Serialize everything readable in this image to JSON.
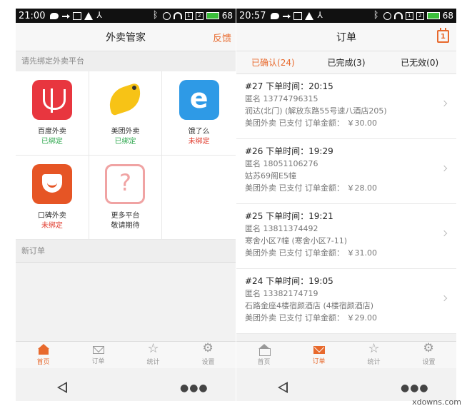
{
  "left_screen": {
    "status": {
      "time": "21:00",
      "battery": "68"
    },
    "header": {
      "title": "外卖管家",
      "feedback": "反馈"
    },
    "bind_section": "请先绑定外卖平台",
    "platforms": [
      {
        "name": "百度外卖",
        "status": "已绑定",
        "icon": "baidu-waimai-logo"
      },
      {
        "name": "美团外卖",
        "status": "已绑定",
        "icon": "meituan-waimai-logo"
      },
      {
        "name": "饿了么",
        "status": "未绑定",
        "icon": "eleme-logo"
      },
      {
        "name": "口碑外卖",
        "status": "未绑定",
        "icon": "koubei-waimai-logo"
      },
      {
        "name": "更多平台",
        "status": "敬请期待",
        "icon": "question-icon"
      }
    ],
    "new_orders_section": "新订单",
    "tabs": [
      "首页",
      "订单",
      "统计",
      "设置"
    ]
  },
  "right_screen": {
    "status": {
      "time": "20:57",
      "battery": "68"
    },
    "header": {
      "title": "订单"
    },
    "order_tabs": [
      "已确认(24)",
      "已完成(3)",
      "已无效(0)"
    ],
    "orders": [
      {
        "head": "#27 下单时间：20:15",
        "name": "匿名 13774796315",
        "address": "润达(北门) (解放东路55号速八酒店205)",
        "summary": "美团外卖 已支付 订单金额： ￥30.00"
      },
      {
        "head": "#26 下单时间：19:29",
        "name": "匿名 18051106276",
        "address": "姑苏69阁E5幢",
        "summary": "美团外卖 已支付 订单金额： ￥28.00"
      },
      {
        "head": "#25 下单时间：19:21",
        "name": "匿名 13811374492",
        "address": "寒舍小区7幢 (寒舍小区7-11)",
        "summary": "美团外卖 已支付 订单金额： ￥31.00"
      },
      {
        "head": "#24 下单时间：19:05",
        "name": "匿名 13382174719",
        "address": "石路金座4楼宿颜酒店 (4楼宿颜酒店)",
        "summary": "美团外卖 已支付 订单金额： ￥29.00"
      }
    ],
    "tabs": [
      "首页",
      "订单",
      "统计",
      "设置"
    ]
  },
  "watermark": "xdowns.com",
  "colors": {
    "accent": "#e8692c",
    "bound": "#2fa84f",
    "unbound": "#e03a2c"
  }
}
